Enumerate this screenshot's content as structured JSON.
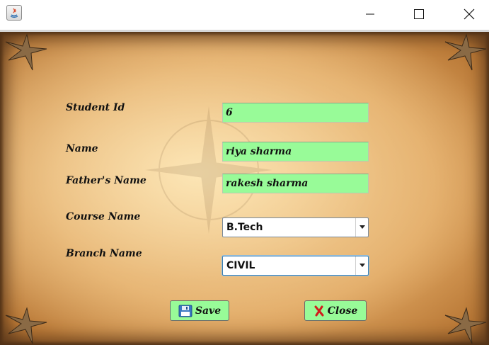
{
  "window": {
    "title": "",
    "controls": {
      "minimize": "minimize-icon",
      "maximize": "maximize-icon",
      "close": "close-icon"
    }
  },
  "form": {
    "student_id": {
      "label": "Student Id",
      "value": "6"
    },
    "name": {
      "label": "Name",
      "value": "riya sharma"
    },
    "father_name": {
      "label": "Father's Name",
      "value": "rakesh sharma"
    },
    "course": {
      "label": "Course Name",
      "selected": "B.Tech"
    },
    "branch": {
      "label": "Branch Name",
      "selected": "CIVIL"
    }
  },
  "buttons": {
    "save": {
      "label": "Save",
      "icon": "floppy-disk-icon"
    },
    "close": {
      "label": "Close",
      "icon": "red-x-icon"
    }
  },
  "colors": {
    "field_bg": "#98fb98",
    "button_bg": "#98fb98",
    "parchment": "#e0a762"
  }
}
